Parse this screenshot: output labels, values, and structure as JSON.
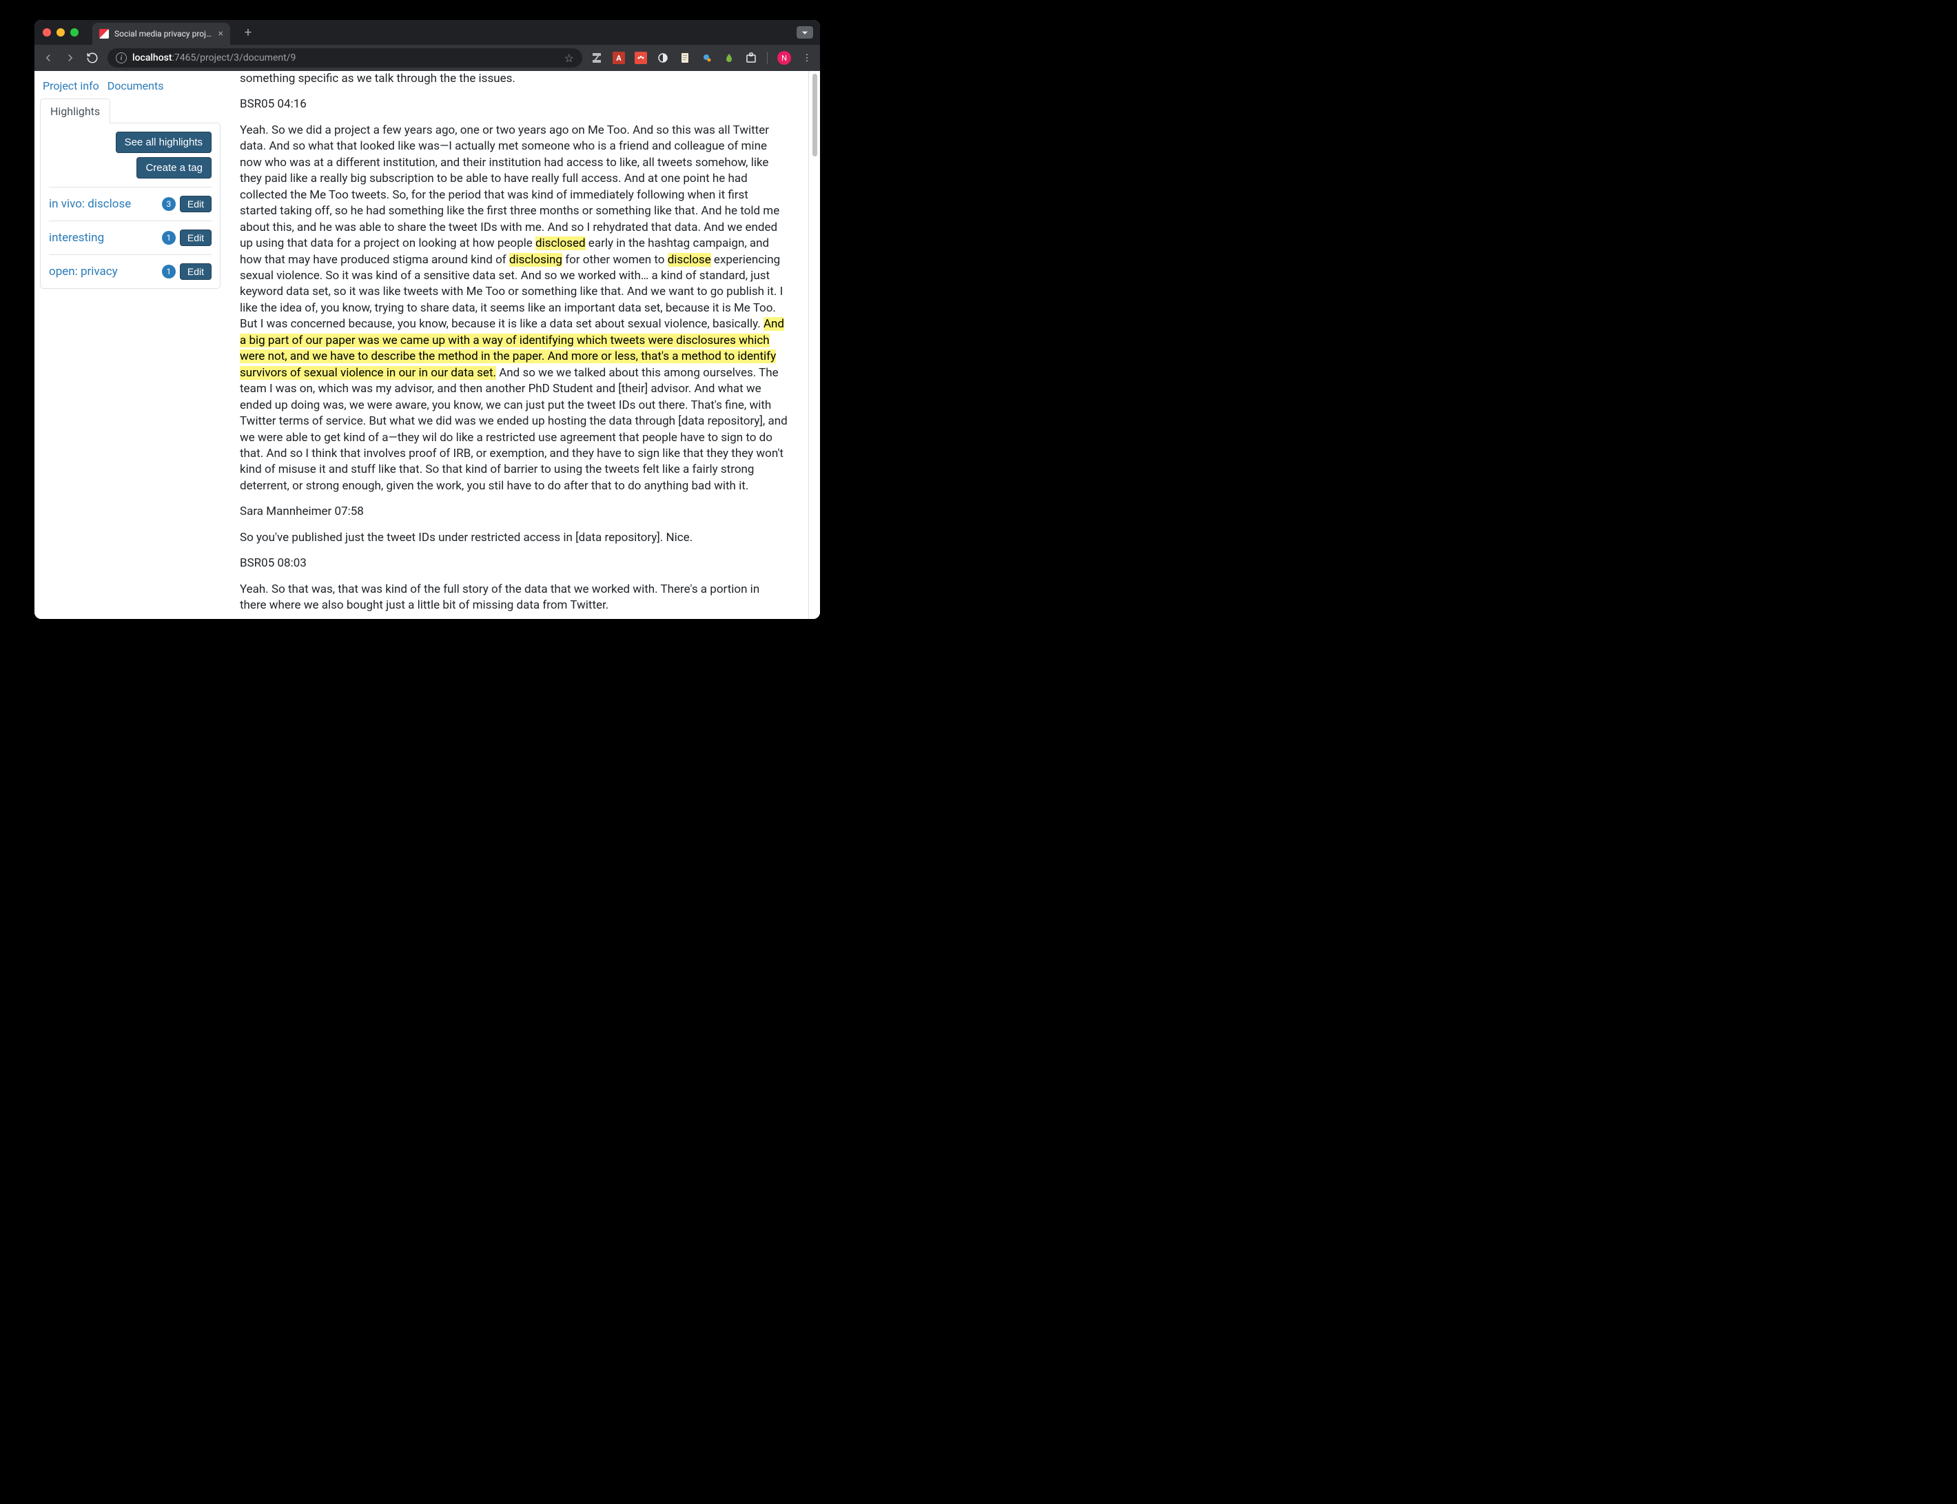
{
  "browser": {
    "tab_title": "Social media privacy project p",
    "url_host": "localhost",
    "url_port": ":7465",
    "url_path": "/project/3/document/9",
    "avatar_letter": "N"
  },
  "sidebar": {
    "nav": {
      "project_info": "Project info",
      "documents": "Documents"
    },
    "active_tab": "Highlights",
    "see_all": "See all highlights",
    "create_tag": "Create a tag",
    "edit_label": "Edit",
    "tags": [
      {
        "name": "in vivo: disclose",
        "count": "3"
      },
      {
        "name": "interesting",
        "count": "1"
      },
      {
        "name": "open: privacy",
        "count": "1"
      }
    ]
  },
  "document": {
    "p0": "something specific as we talk through the the issues.",
    "s1": "BSR05 04:16",
    "p1a": "Yeah. So we did a project a few years ago, one or two years ago on Me Too. And so this was all Twitter data. And so what that looked like was—I actually met someone who is a friend and colleague of mine now who was at a different institution, and their institution had access to like, all tweets somehow, like they paid like a really big subscription to be able to have really full access. And at one point he had collected the Me Too tweets. So, for the period that was kind of immediately following when it first started taking off, so he had something like the first three months or something like that. And he told me about this, and he was able to share the tweet IDs with me. And so I rehydrated that data. And we ended up using that data for a project on looking at how people ",
    "h1": "disclosed",
    "p1b": " early in the hashtag campaign, and how that may have produced stigma around kind of ",
    "h2": "disclosing",
    "p1c": " for other women to ",
    "h3": "disclose",
    "p1d": " experiencing sexual violence. So it was kind of a sensitive data set. And so we worked with… a kind of standard, just keyword data set, so it was like tweets with Me Too or something like that. And we want to go publish it. I like the idea of, you know, trying to share data, it seems like an important data set, because it is Me Too. But I was concerned because, you know, because it is like a data set about sexual violence, basically. ",
    "h4": "And a big part of our paper was we came up with a way of identifying which tweets were disclosures which were not, and we have to describe the method in the paper. And more or less, that's a method to identify survivors of sexual violence in our in our data set.",
    "p1e": " And so we we talked about this among ourselves. The team I was on, which was my advisor, and then another PhD Student and [their] advisor. And what we ended up doing was, we were aware, you know, we can just put the tweet IDs out there. That's fine, with Twitter terms of service. But what we did was we ended up hosting the data through [data repository], and we were able to get kind of a—they wil do like a restricted use agreement that people have to sign to do that. And so I think that involves proof of IRB, or exemption, and they have to sign like that they they won't kind of misuse it and stuff like that. So that kind of barrier to using the tweets felt like a fairly strong deterrent, or strong enough, given the work, you stil have to do after that to do anything bad with it.",
    "s2": "Sara Mannheimer 07:58",
    "p2": "So you've published just the tweet IDs under restricted access in [data repository]. Nice.",
    "s3": "BSR05 08:03",
    "p3": "Yeah. So that was, that was kind of the full story of the data that we worked with. There's a portion in there where we also bought just a little bit of missing data from Twitter."
  }
}
